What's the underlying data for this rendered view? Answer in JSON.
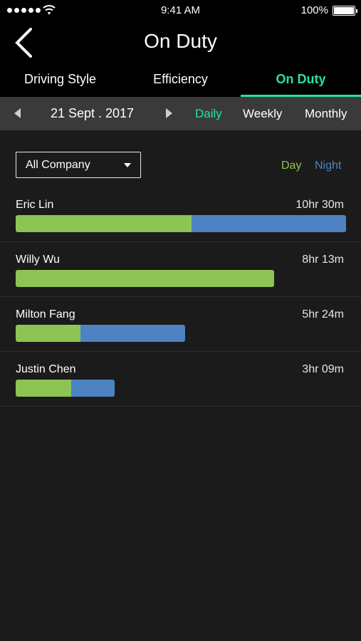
{
  "status_bar": {
    "time": "9:41 AM",
    "battery": "100%",
    "signal_icon": "signal-dots-icon",
    "wifi_icon": "wifi-icon",
    "battery_icon": "battery-icon"
  },
  "header": {
    "title": "On Duty",
    "back_icon": "chevron-left-icon"
  },
  "tabs": [
    {
      "label": "Driving Style",
      "active": false
    },
    {
      "label": "Efficiency",
      "active": false
    },
    {
      "label": "On Duty",
      "active": true
    }
  ],
  "date_nav": {
    "date": "21 Sept . 2017",
    "periods": [
      {
        "label": "Daily",
        "active": true
      },
      {
        "label": "Weekly",
        "active": false
      },
      {
        "label": "Monthly",
        "active": false
      }
    ]
  },
  "filter": {
    "selected": "All Company"
  },
  "legend": {
    "day": "Day",
    "night": "Night"
  },
  "colors": {
    "accent": "#27e0a8",
    "day": "#8dc453",
    "night": "#4e83c3",
    "background": "#1b1b1b",
    "header": "#000000",
    "date_bar": "#3a3a3a"
  },
  "drivers": [
    {
      "name": "Eric Lin",
      "hours": "10hr  30m",
      "day_minutes": 335,
      "night_minutes": 295
    },
    {
      "name": "Willy Wu",
      "hours": "8hr  13m",
      "day_minutes": 493,
      "night_minutes": 0
    },
    {
      "name": "Milton Fang",
      "hours": "5hr  24m",
      "day_minutes": 124,
      "night_minutes": 200
    },
    {
      "name": "Justin Chen",
      "hours": "3hr  09m",
      "day_minutes": 106,
      "night_minutes": 83
    }
  ]
}
